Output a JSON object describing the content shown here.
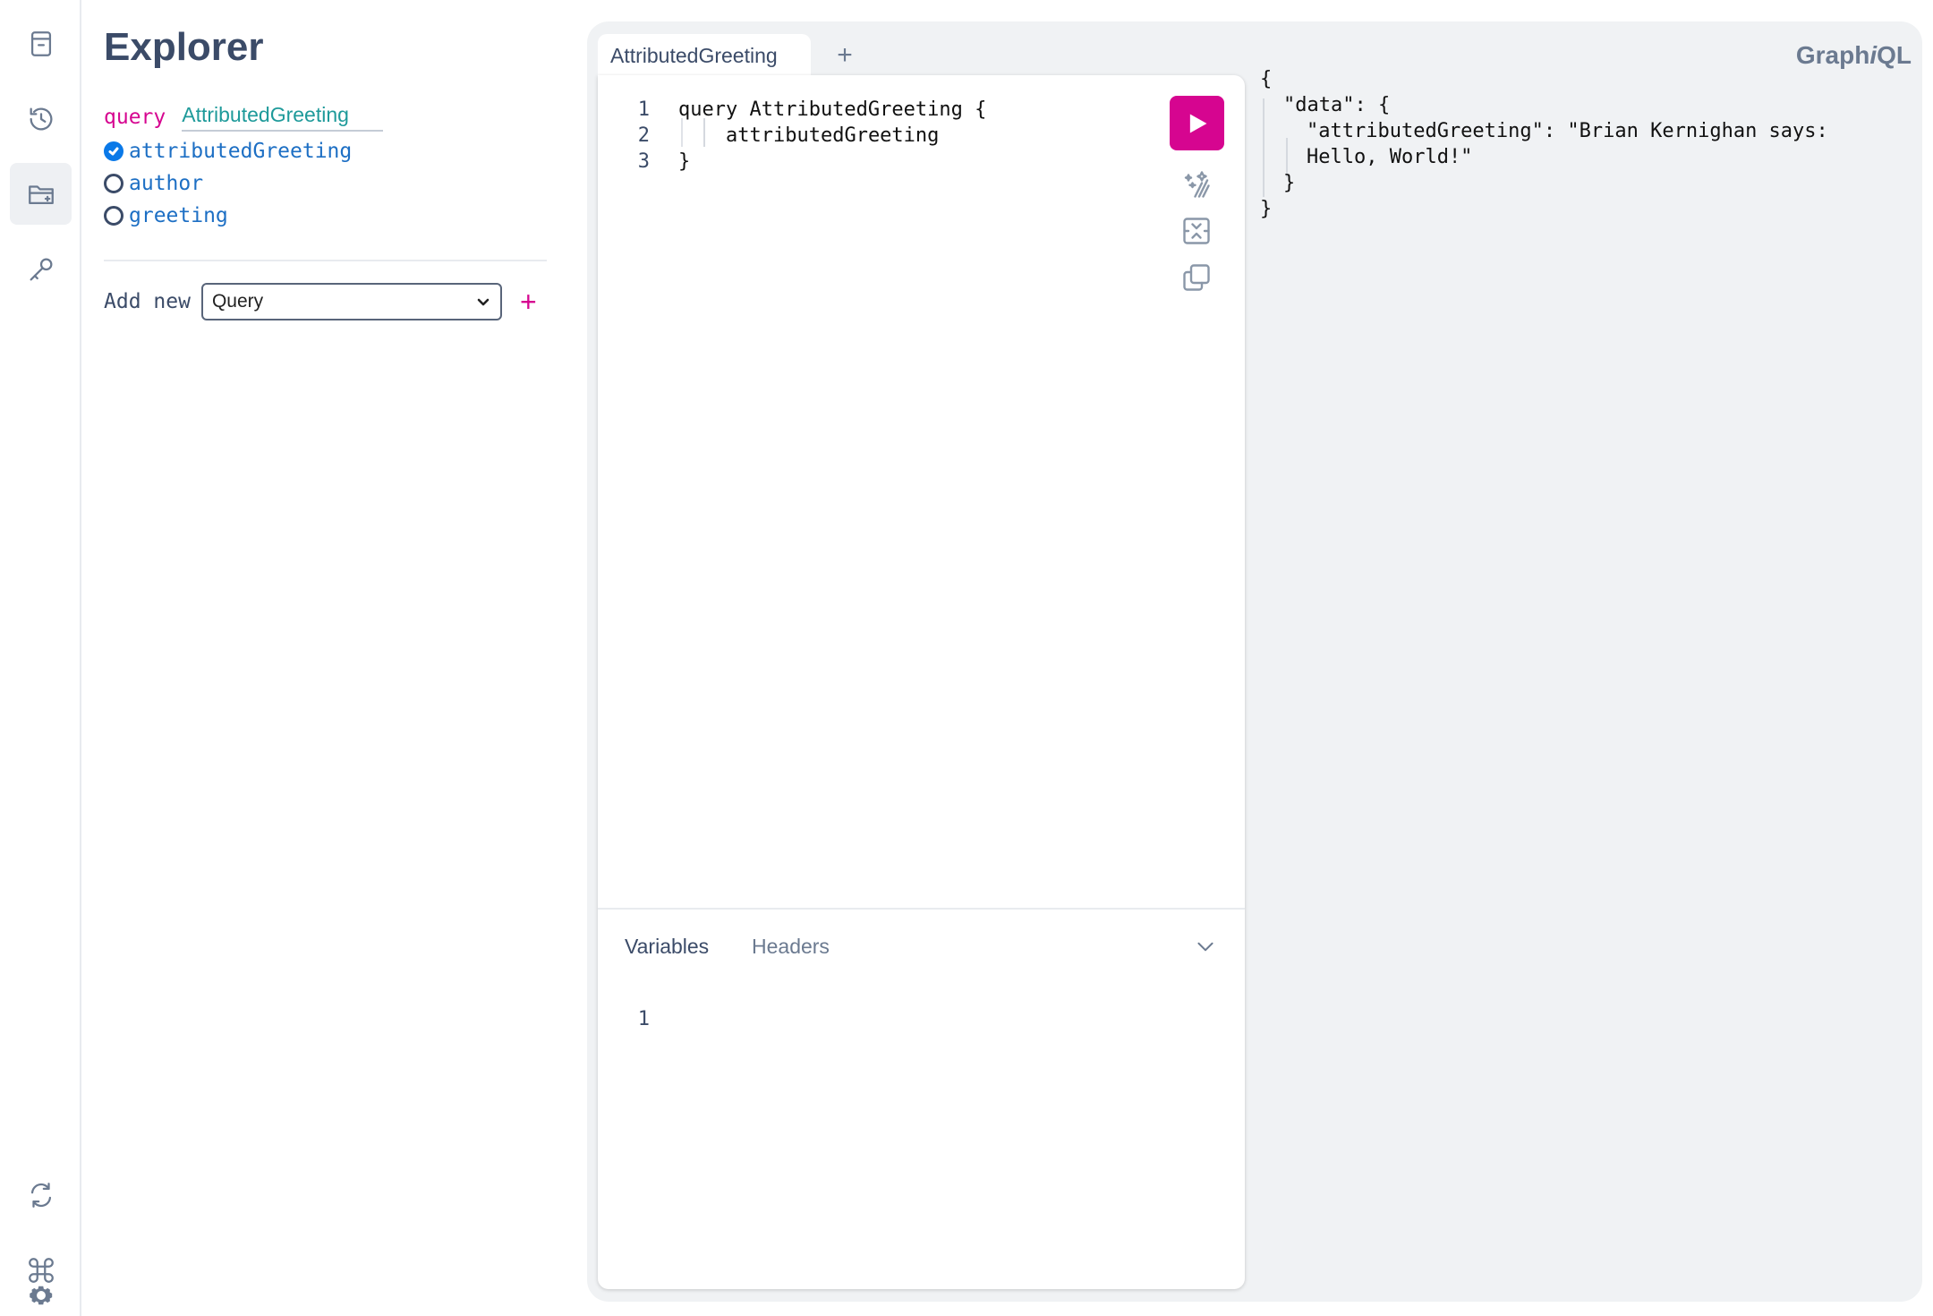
{
  "sidebar": {
    "top_icons": [
      "docs-icon",
      "history-icon",
      "explorer-icon",
      "key-icon"
    ],
    "bottom_icons": [
      "refresh-icon",
      "command-icon",
      "settings-icon"
    ]
  },
  "explorer": {
    "title": "Explorer",
    "operation_keyword": "query",
    "operation_name": "AttributedGreeting",
    "fields": [
      {
        "name": "attributedGreeting",
        "checked": true
      },
      {
        "name": "author",
        "checked": false
      },
      {
        "name": "greeting",
        "checked": false
      }
    ],
    "add_new_label": "Add new",
    "add_new_selected": "Query",
    "add_new_plus": "+"
  },
  "tabs": {
    "active": "AttributedGreeting",
    "add": "+"
  },
  "brand": {
    "prefix": "Graph",
    "italic": "i",
    "suffix": "QL"
  },
  "editor": {
    "line_numbers": [
      "1",
      "2",
      "3"
    ],
    "lines": [
      "query AttributedGreeting {",
      "attributedGreeting",
      "}"
    ]
  },
  "toolbar_icons": [
    "run-icon",
    "prettify-icon",
    "merge-icon",
    "copy-icon"
  ],
  "variables": {
    "tab_variables": "Variables",
    "tab_headers": "Headers",
    "line_numbers": [
      "1"
    ]
  },
  "result": {
    "lines": [
      "{",
      "\"data\": {",
      "\"attributedGreeting\": \"Brian Kernighan says:",
      "Hello, World!\"",
      "}",
      "}"
    ]
  },
  "colors": {
    "accent": "#d60590",
    "checkbox": "#0a79e8",
    "keyword": "#d60590",
    "field": "#1d6fc4",
    "opname": "#1e9a9a"
  }
}
